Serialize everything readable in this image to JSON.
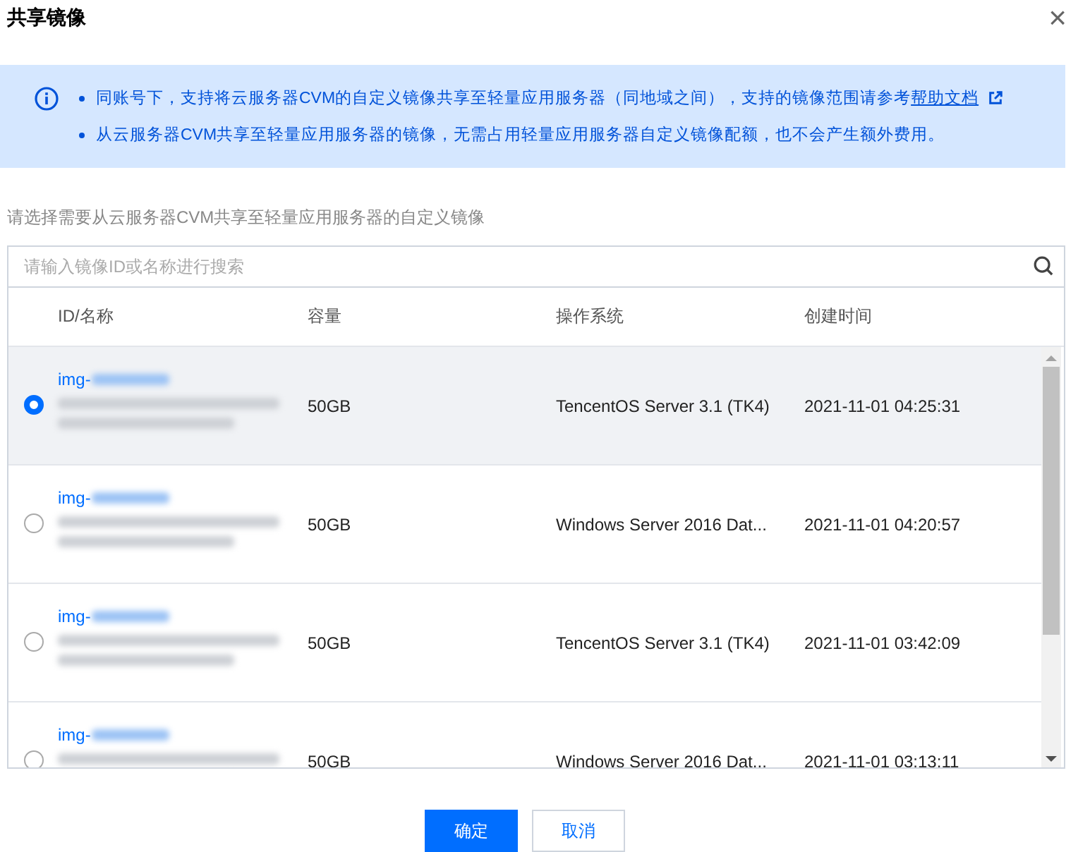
{
  "dialog": {
    "title": "共享镜像",
    "close": "×"
  },
  "notice": {
    "items": [
      {
        "text": "同账号下，支持将云服务器CVM的自定义镜像共享至轻量应用服务器（同地域之间），支持的镜像范围请参考",
        "link": "帮助文档"
      },
      {
        "text": "从云服务器CVM共享至轻量应用服务器的镜像，无需占用轻量应用服务器自定义镜像配额，也不会产生额外费用。"
      }
    ]
  },
  "prompt": "请选择需要从云服务器CVM共享至轻量应用服务器的自定义镜像",
  "search": {
    "placeholder": "请输入镜像ID或名称进行搜索"
  },
  "table": {
    "columns": [
      "ID/名称",
      "容量",
      "操作系统",
      "创建时间"
    ],
    "rows": [
      {
        "id": "img-",
        "size": "50GB",
        "os": "TencentOS Server 3.1 (TK4)",
        "created": "2021-11-01 04:25:31",
        "selected": true
      },
      {
        "id": "img-",
        "size": "50GB",
        "os": "Windows Server 2016 Dat...",
        "created": "2021-11-01 04:20:57",
        "selected": false
      },
      {
        "id": "img-",
        "size": "50GB",
        "os": "TencentOS Server 3.1 (TK4)",
        "created": "2021-11-01 03:42:09",
        "selected": false
      },
      {
        "id": "img-",
        "size": "50GB",
        "os": "Windows Server 2016 Dat...",
        "created": "2021-11-01 03:13:11",
        "selected": false
      }
    ]
  },
  "buttons": [
    {
      "label": "确定",
      "kind": "primary"
    },
    {
      "label": "取消",
      "kind": "secondary"
    }
  ]
}
